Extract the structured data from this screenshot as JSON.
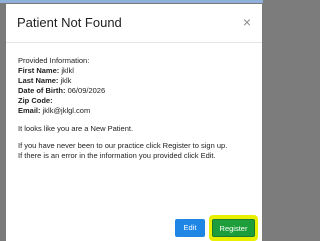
{
  "modal": {
    "title": "Patient Not Found",
    "close_label": "×",
    "provided_heading": "Provided Information:",
    "fields": [
      {
        "label": "First Name:",
        "value": "jklkl"
      },
      {
        "label": "Last Name:",
        "value": "jklk"
      },
      {
        "label": "Date of Birth:",
        "value": "06/09/2026"
      },
      {
        "label": "Zip Code:",
        "value": ""
      },
      {
        "label": "Email:",
        "value": "jklk@jklgl.com"
      }
    ],
    "new_patient_text": "It looks like you are a New Patient.",
    "instructions_line1": "If you have never been to our practice click Register to sign up.",
    "instructions_line2": "If there is an error in the information you provided click Edit.",
    "edit_label": "Edit",
    "register_label": "Register"
  },
  "colors": {
    "edit_button": "#1f86e6",
    "register_button": "#1d9e3a",
    "register_highlight": "#e8f000"
  }
}
